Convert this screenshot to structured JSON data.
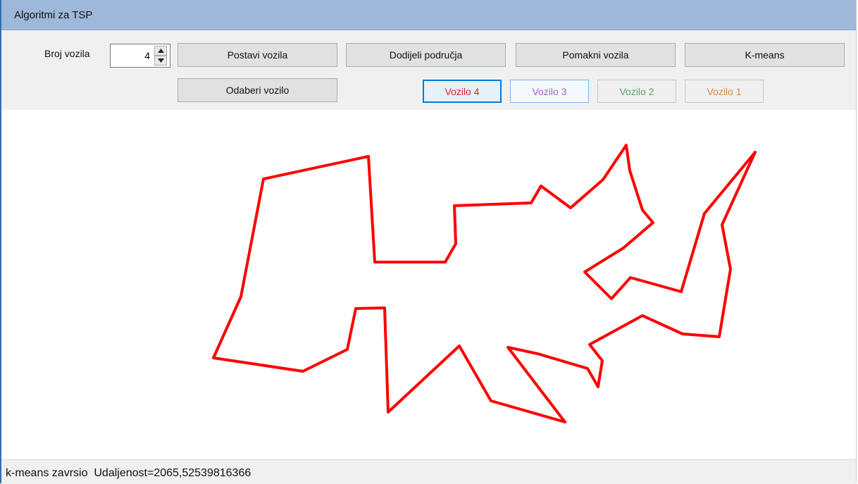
{
  "window": {
    "title": "Algoritmi za TSP"
  },
  "toolbar": {
    "broj_vozila_label": "Broj vozila",
    "broj_vozila_value": "4",
    "postavi_vozila": "Postavi vozila",
    "dodijeli_podrucja": "Dodijeli područja",
    "pomakni_vozila": "Pomakni vozila",
    "kmeans": "K-means",
    "odaberi_vozilo": "Odaberi vozilo"
  },
  "vehicles": [
    {
      "label": "Vozilo 4",
      "color": "#e0201e",
      "selected": true
    },
    {
      "label": "Vozilo 3",
      "color": "#b15cc9",
      "selected": false
    },
    {
      "label": "Vozilo 2",
      "color": "#55a86a",
      "selected": false
    },
    {
      "label": "Vozilo 1",
      "color": "#d98a3a",
      "selected": false
    }
  ],
  "route": {
    "color": "#ff0000"
  },
  "status": {
    "text": "k-means zavrsio",
    "distance": "Udaljenost=2065,52539816366"
  }
}
